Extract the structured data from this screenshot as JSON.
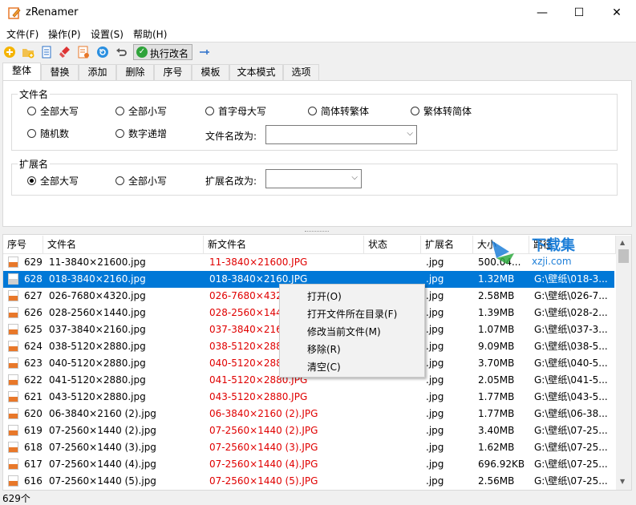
{
  "window": {
    "title": "zRenamer",
    "minimize": "—",
    "maximize": "☐",
    "close": "✕"
  },
  "menu": [
    "文件(F)",
    "操作(P)",
    "设置(S)",
    "帮助(H)"
  ],
  "toolbar": {
    "execute_label": "执行改名"
  },
  "tabs": [
    "整体",
    "替换",
    "添加",
    "删除",
    "序号",
    "模板",
    "文本模式",
    "选项"
  ],
  "filename_group": {
    "title": "文件名",
    "options": [
      "全部大写",
      "全部小写",
      "首字母大写",
      "简体转繁体",
      "繁体转简体",
      "随机数",
      "数字递增"
    ],
    "change_to_label": "文件名改为:"
  },
  "ext_group": {
    "title": "扩展名",
    "options": [
      "全部大写",
      "全部小写"
    ],
    "selected": "全部大写",
    "change_to_label": "扩展名改为:"
  },
  "table": {
    "columns": [
      "序号",
      "文件名",
      "新文件名",
      "状态",
      "扩展名",
      "大小",
      "路径"
    ],
    "rows": [
      {
        "no": "629",
        "name": "11-3840×21600.jpg",
        "newname": "11-3840×21600.JPG",
        "ext": ".jpg",
        "size": "500.04...",
        "path": ""
      },
      {
        "no": "628",
        "name": "018-3840×2160.jpg",
        "newname": "018-3840×2160.JPG",
        "ext": ".jpg",
        "size": "1.32MB",
        "path": "G:\\壁纸\\018-3..."
      },
      {
        "no": "627",
        "name": "026-7680×4320.jpg",
        "newname": "026-7680×4320",
        "ext": ".jpg",
        "size": "2.58MB",
        "path": "G:\\壁纸\\026-7..."
      },
      {
        "no": "626",
        "name": "028-2560×1440.jpg",
        "newname": "028-2560×1440",
        "ext": ".jpg",
        "size": "1.39MB",
        "path": "G:\\壁纸\\028-2..."
      },
      {
        "no": "625",
        "name": "037-3840×2160.jpg",
        "newname": "037-3840×2160",
        "ext": ".jpg",
        "size": "1.07MB",
        "path": "G:\\壁纸\\037-3..."
      },
      {
        "no": "624",
        "name": "038-5120×2880.jpg",
        "newname": "038-5120×2880",
        "ext": ".jpg",
        "size": "9.09MB",
        "path": "G:\\壁纸\\038-5..."
      },
      {
        "no": "623",
        "name": "040-5120×2880.jpg",
        "newname": "040-5120×2880",
        "ext": ".jpg",
        "size": "3.70MB",
        "path": "G:\\壁纸\\040-5..."
      },
      {
        "no": "622",
        "name": "041-5120×2880.jpg",
        "newname": "041-5120×2880.JPG",
        "ext": ".jpg",
        "size": "2.05MB",
        "path": "G:\\壁纸\\041-5..."
      },
      {
        "no": "621",
        "name": "043-5120×2880.jpg",
        "newname": "043-5120×2880.JPG",
        "ext": ".jpg",
        "size": "1.77MB",
        "path": "G:\\壁纸\\043-5..."
      },
      {
        "no": "620",
        "name": "06-3840×2160 (2).jpg",
        "newname": "06-3840×2160 (2).JPG",
        "ext": ".jpg",
        "size": "1.77MB",
        "path": "G:\\壁纸\\06-38..."
      },
      {
        "no": "619",
        "name": "07-2560×1440 (2).jpg",
        "newname": "07-2560×1440 (2).JPG",
        "ext": ".jpg",
        "size": "3.40MB",
        "path": "G:\\壁纸\\07-25..."
      },
      {
        "no": "618",
        "name": "07-2560×1440 (3).jpg",
        "newname": "07-2560×1440 (3).JPG",
        "ext": ".jpg",
        "size": "1.62MB",
        "path": "G:\\壁纸\\07-25..."
      },
      {
        "no": "617",
        "name": "07-2560×1440 (4).jpg",
        "newname": "07-2560×1440 (4).JPG",
        "ext": ".jpg",
        "size": "696.92KB",
        "path": "G:\\壁纸\\07-25..."
      },
      {
        "no": "616",
        "name": "07-2560×1440 (5).jpg",
        "newname": "07-2560×1440 (5).JPG",
        "ext": ".jpg",
        "size": "2.56MB",
        "path": "G:\\壁纸\\07-25..."
      }
    ],
    "selected_row": 1
  },
  "context_menu": [
    "打开(O)",
    "打开文件所在目录(F)",
    "修改当前文件(M)",
    "移除(R)",
    "清空(C)"
  ],
  "status": {
    "count": "629个"
  },
  "watermark": {
    "text1": "下载集",
    "text2": "xzji.com"
  },
  "colors": {
    "accent": "#0078d7",
    "new_name": "#e00000",
    "exec_green": "#2fa33a"
  }
}
